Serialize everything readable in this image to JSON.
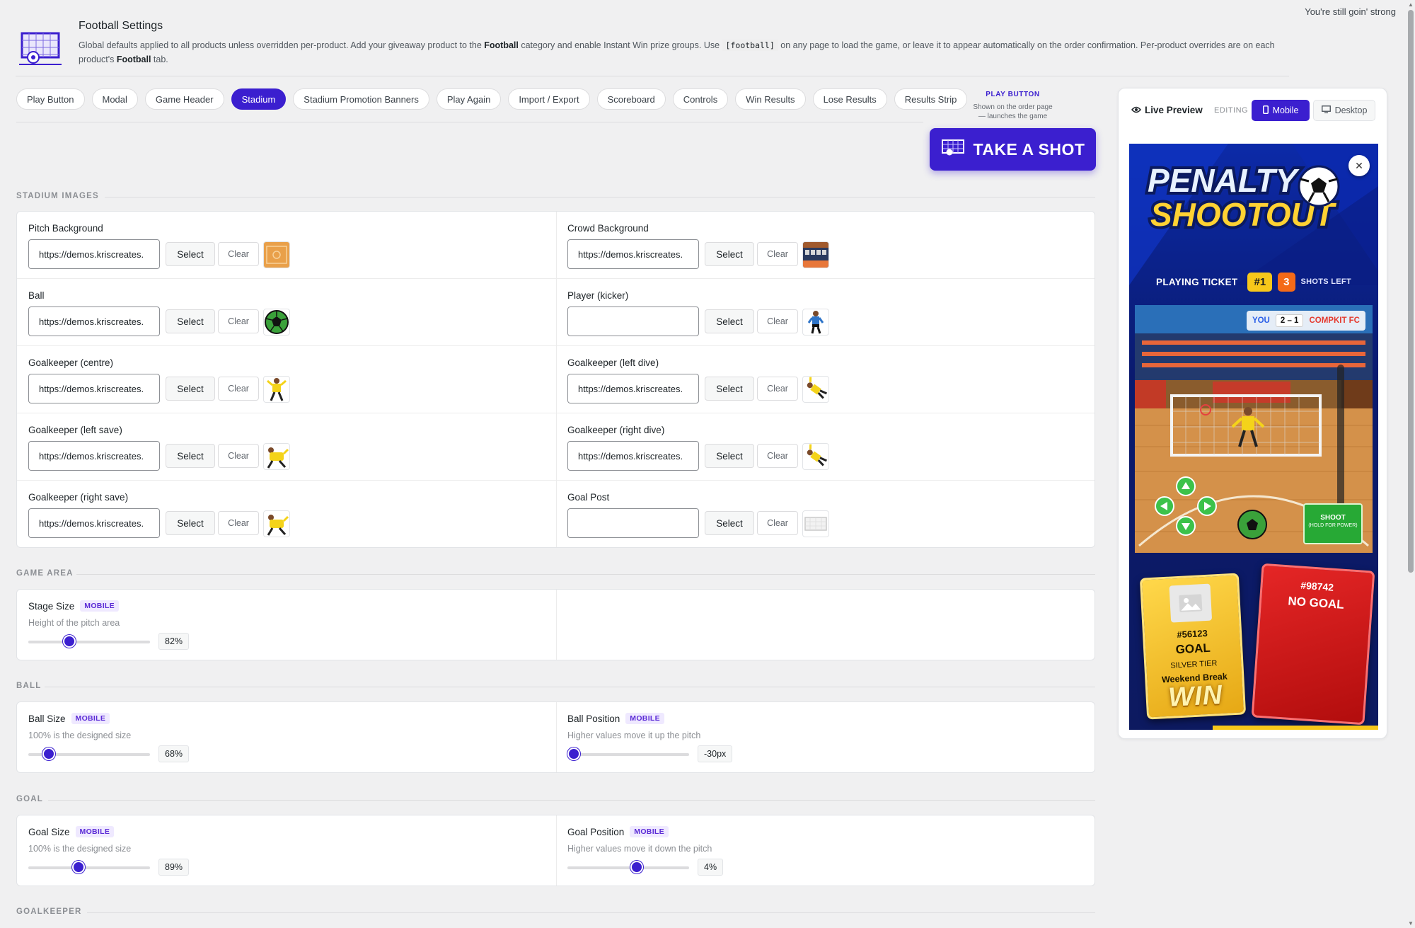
{
  "top_message": "You're still goin' strong",
  "header": {
    "title": "Football Settings",
    "desc_1": "Global defaults applied to all products unless overridden per-product. Add your giveaway product to the ",
    "desc_bold_1": "Football",
    "desc_2": " category and enable Instant Win prize groups. Use ",
    "desc_code": "[football]",
    "desc_3": " on any page to load the game, or leave it to appear automatically on the order confirmation. Per-product overrides are on each product's ",
    "desc_bold_2": "Football",
    "desc_4": " tab."
  },
  "tabs": [
    {
      "label": "Play Button"
    },
    {
      "label": "Modal"
    },
    {
      "label": "Game Header"
    },
    {
      "label": "Stadium",
      "active": true
    },
    {
      "label": "Stadium Promotion Banners"
    },
    {
      "label": "Play Again"
    },
    {
      "label": "Import / Export"
    },
    {
      "label": "Scoreboard"
    },
    {
      "label": "Controls"
    },
    {
      "label": "Win Results"
    },
    {
      "label": "Lose Results"
    },
    {
      "label": "Results Strip"
    }
  ],
  "play_button": {
    "title": "PLAY BUTTON",
    "sub_1": "Shown on the order page",
    "sub_2": "— launches the game",
    "label": "TAKE A SHOT"
  },
  "sections": {
    "stadium_images": "STADIUM IMAGES",
    "game_area": "GAME AREA",
    "ball": "BALL",
    "goal": "GOAL",
    "goalkeeper": "GOALKEEPER"
  },
  "buttons": {
    "select": "Select",
    "clear": "Clear"
  },
  "stadium_images": [
    {
      "label": "Pitch Background",
      "value": "https://demos.kriscreates.",
      "thumb": "pitch"
    },
    {
      "label": "Crowd Background",
      "value": "https://demos.kriscreates.",
      "thumb": "crowd"
    },
    {
      "label": "Ball",
      "value": "https://demos.kriscreates.",
      "thumb": "ball"
    },
    {
      "label": "Player (kicker)",
      "value": "",
      "thumb": "kicker"
    },
    {
      "label": "Goalkeeper (centre)",
      "value": "https://demos.kriscreates.",
      "thumb": "keeper"
    },
    {
      "label": "Goalkeeper (left dive)",
      "value": "https://demos.kriscreates.",
      "thumb": "dive"
    },
    {
      "label": "Goalkeeper (left save)",
      "value": "https://demos.kriscreates.",
      "thumb": "save"
    },
    {
      "label": "Goalkeeper (right dive)",
      "value": "https://demos.kriscreates.",
      "thumb": "dive"
    },
    {
      "label": "Goalkeeper (right save)",
      "value": "https://demos.kriscreates.",
      "thumb": "save"
    },
    {
      "label": "Goal Post",
      "value": "",
      "thumb": "goalpost"
    }
  ],
  "sliders": {
    "stage_size": {
      "label": "Stage Size",
      "badge": "MOBILE",
      "desc": "Height of the pitch area",
      "display": "82%",
      "fraction": 0.34
    },
    "ball_size": {
      "label": "Ball Size",
      "badge": "MOBILE",
      "desc": "100% is the designed size",
      "display": "68%",
      "fraction": 0.17
    },
    "ball_position": {
      "label": "Ball Position",
      "badge": "MOBILE",
      "desc": "Higher values move it up the pitch",
      "display": "-30px",
      "fraction": 0.05
    },
    "goal_size": {
      "label": "Goal Size",
      "badge": "MOBILE",
      "desc": "100% is the designed size",
      "display": "89%",
      "fraction": 0.41
    },
    "goal_position": {
      "label": "Goal Position",
      "badge": "MOBILE",
      "desc": "Higher values move it down the pitch",
      "display": "4%",
      "fraction": 0.57
    }
  },
  "preview": {
    "title": "Live Preview",
    "editing": "EDITING",
    "mobile": "Mobile",
    "desktop": "Desktop",
    "game_title_1": "PENALTY",
    "game_title_2": "SHOOTOUT",
    "ticket_label": "PLAYING TICKET",
    "ticket_number": "#1",
    "shots_number": "3",
    "shots_label": "SHOTS LEFT",
    "score_you": "YOU",
    "score_value": "2 – 1",
    "score_opponent": "COMPKIT FC",
    "shoot_main": "SHOOT",
    "shoot_sub": "(HOLD FOR POWER)",
    "win_card": {
      "id": "#56123",
      "result": "GOAL",
      "tier": "SILVER TIER",
      "prize": "Weekend Break",
      "banner": "WIN"
    },
    "lose_card": {
      "id": "#98742",
      "result": "NO GOAL"
    }
  },
  "colors": {
    "accent": "#3b1fcf",
    "badge": "#5b2bd6"
  }
}
